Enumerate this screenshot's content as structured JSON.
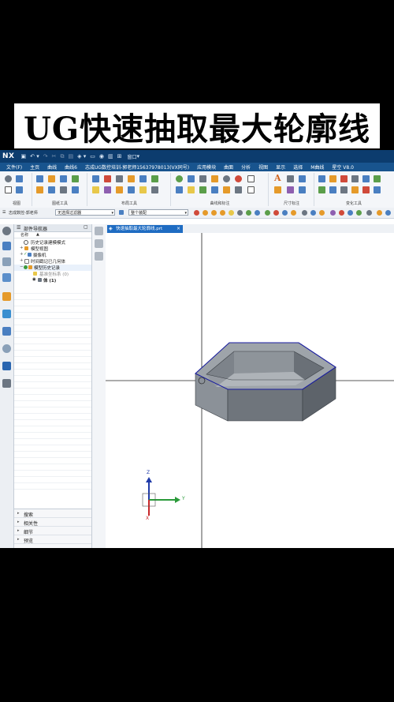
{
  "banner": {
    "title": "UG快速抽取最大轮廓线"
  },
  "app": {
    "logo": "NX",
    "window_label": "窗口",
    "menu": [
      "文件(F)",
      "主页",
      "曲线",
      "曲线6",
      "志成UG数控培训-郭老师15637978013(VX同号)",
      "应用模块",
      "曲面",
      "分析",
      "视图",
      "显示",
      "选择",
      "M曲线",
      "星空 V8.0"
    ],
    "ribbon_groups": [
      "视图",
      "图纸工具",
      "布局工具",
      "曲线和标注",
      "尺寸标注",
      "变化工具"
    ],
    "selection": {
      "label": "志成数控-郭老师",
      "filter": "无选择过滤器",
      "scope": "整个装配"
    },
    "navigator": {
      "title": "部件导航器",
      "column_name": "名称",
      "rows": [
        {
          "label": "历史记录建模模式"
        },
        {
          "label": "模型视图"
        },
        {
          "label": "摄像机"
        },
        {
          "label": "时间戳记已几何体"
        },
        {
          "label": "模型历史记录"
        },
        {
          "label": "基准坐标系 (0)"
        },
        {
          "label": "体 (1)"
        }
      ],
      "bottom_sections": [
        "搜索",
        "相关性",
        "细节",
        "预览"
      ]
    },
    "tab_label": "快速抽取最大轮廓线.prt",
    "axis_labels": {
      "z": "Z",
      "y": "Y",
      "x": "X"
    },
    "colors": {
      "title_bar": "#0c3c6e",
      "menu_bar": "#18548e",
      "tab_active": "#1f6cc2",
      "part_outline": "#1a1ea0"
    }
  }
}
